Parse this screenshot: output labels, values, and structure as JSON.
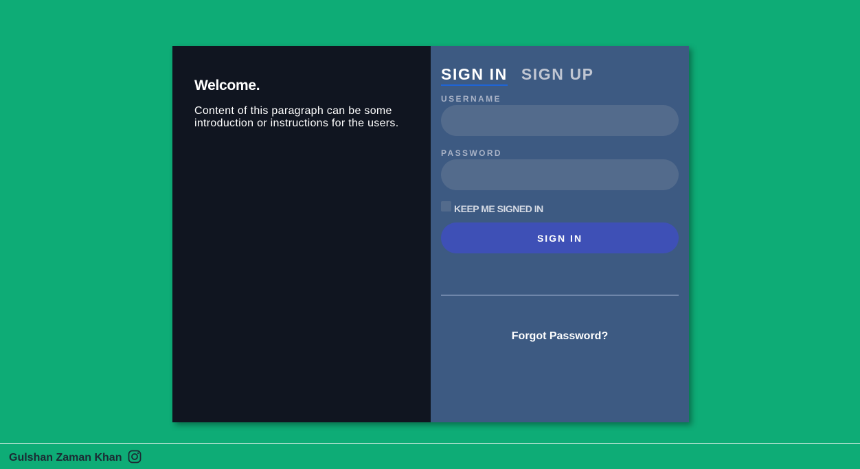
{
  "welcome": {
    "title": "Welcome.",
    "text": "Content of this paragraph can be some introduction or instructions for the users."
  },
  "tabs": [
    {
      "label": "SIGN IN",
      "active": true
    },
    {
      "label": "SIGN UP",
      "active": false
    }
  ],
  "form": {
    "username_label": "USERNAME",
    "username_value": "",
    "password_label": "PASSWORD",
    "password_value": "",
    "keep_signed_in_label": "KEEP ME SIGNED IN",
    "keep_signed_in_checked": false,
    "submit_label": "SIGN IN",
    "forgot_label": "Forgot Password?"
  },
  "footer": {
    "author": "Gulshan Zaman Khan",
    "social_icon": "instagram-icon"
  },
  "colors": {
    "background": "#0eac76",
    "left_panel": "#101520",
    "right_panel": "#3d5a82",
    "input_bg": "#536b8c",
    "button": "#3e50b6",
    "tab_underline": "#1f64d6"
  }
}
